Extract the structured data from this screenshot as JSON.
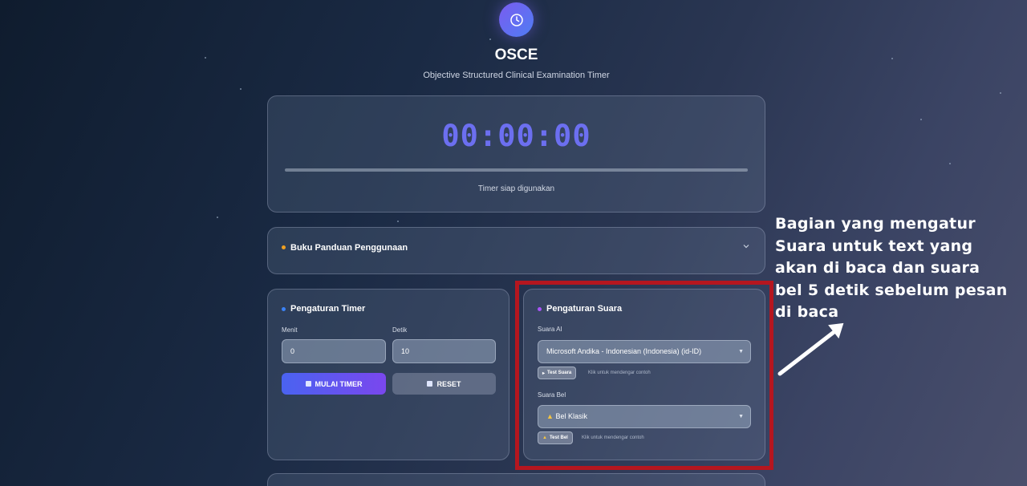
{
  "app": {
    "title": "OSCE",
    "subtitle": "Objective Structured Clinical Examination Timer",
    "icon": "clock-icon",
    "accent": "#6c6ff0"
  },
  "timer": {
    "display": "00:00:00",
    "status": "Timer siap digunakan",
    "progress": 0
  },
  "guide": {
    "title": "Buku Panduan Penggunaan"
  },
  "timer_settings": {
    "title": "Pengaturan Timer",
    "minutes_label": "Menit",
    "minutes_value": "0",
    "seconds_label": "Detik",
    "seconds_value": "10",
    "start_label": "MULAI TIMER",
    "reset_label": "RESET"
  },
  "sound_settings": {
    "title": "Pengaturan Suara",
    "ai_voice_label": "Suara AI",
    "ai_voice_selected": "Microsoft Andika - Indonesian (Indonesia) (id-ID)",
    "test_voice_label": "Test Suara",
    "test_voice_hint": "Klik untuk mendengar contoh",
    "bell_label": "Suara Bel",
    "bell_selected": "Bel Klasik",
    "test_bell_label": "Test Bel",
    "test_bell_hint": "Klik untuk mendengar contoh"
  },
  "annotation": {
    "lines": [
      "Bagian yang mengatur",
      "Suara untuk text yang",
      "akan di baca dan suara",
      "bel 5 detik sebelum pesan",
      "di baca"
    ],
    "color": "#b5161f"
  }
}
